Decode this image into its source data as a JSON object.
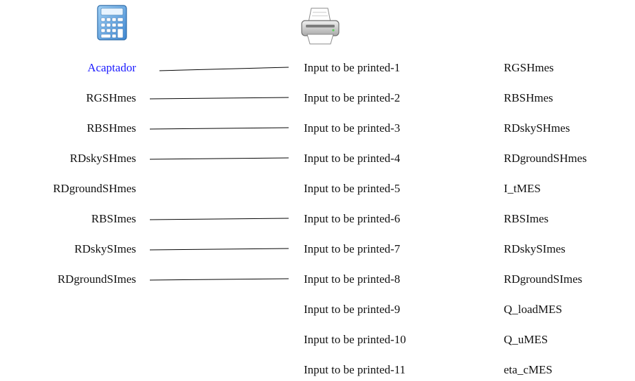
{
  "source": {
    "title": "Acaptador",
    "icon": "calculator-icon",
    "outputs": [
      "RGSHmes",
      "RBSHmes",
      "RDskySHmes",
      "RDgroundSHmes",
      "RBSImes",
      "RDskySImes",
      "RDgroundSImes"
    ]
  },
  "target": {
    "icon": "printer-icon",
    "inputs": [
      {
        "label": "Input to be printed-1",
        "value": "RGSHmes"
      },
      {
        "label": "Input to be printed-2",
        "value": "RBSHmes"
      },
      {
        "label": "Input to be printed-3",
        "value": "RDskySHmes"
      },
      {
        "label": "Input to be printed-4",
        "value": "RDgroundSHmes"
      },
      {
        "label": "Input to be printed-5",
        "value": "I_tMES"
      },
      {
        "label": "Input to be printed-6",
        "value": "RBSImes"
      },
      {
        "label": "Input to be printed-7",
        "value": "RDskySImes"
      },
      {
        "label": "Input to be printed-8",
        "value": "RDgroundSImes"
      },
      {
        "label": "Input to be printed-9",
        "value": "Q_loadMES"
      },
      {
        "label": "Input to be printed-10",
        "value": "Q_uMES"
      },
      {
        "label": "Input to be printed-11",
        "value": "eta_cMES"
      }
    ]
  },
  "connections": [
    {
      "from": "Acaptador",
      "to": 1
    },
    {
      "from": "RGSHmes",
      "to": 2
    },
    {
      "from": "RBSHmes",
      "to": 3
    },
    {
      "from": "RDskySHmes",
      "to": 4
    },
    {
      "from": "RBSImes",
      "to": 6
    },
    {
      "from": "RDskySImes",
      "to": 7
    },
    {
      "from": "RDgroundSImes",
      "to": 8
    }
  ],
  "colors": {
    "title": "#1a1aff",
    "text": "#111111",
    "line": "#000000"
  }
}
